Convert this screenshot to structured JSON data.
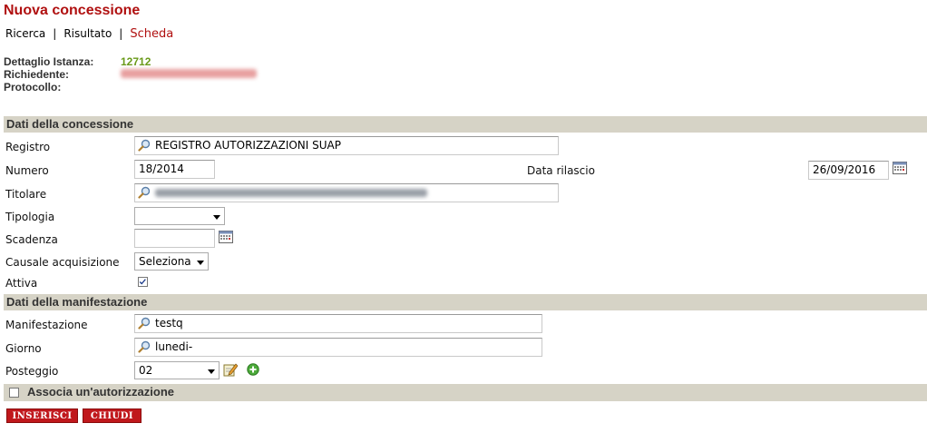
{
  "page_title": "Nuova concessione",
  "breadcrumbs": [
    {
      "label": "Ricerca"
    },
    {
      "label": "Risultato"
    },
    {
      "label": "Scheda"
    }
  ],
  "breadcrumb_separator": "|",
  "detail": {
    "istanza_label": "Dettaglio Istanza:",
    "istanza_value": "12712",
    "richiedente_label": "Richiedente:",
    "protocollo_label": "Protocollo:"
  },
  "sections": {
    "concessione": "Dati della concessione",
    "manifestazione": "Dati della manifestazione",
    "autorizzazione": "Associa un'autorizzazione"
  },
  "form": {
    "registro_label": "Registro",
    "registro_value": "REGISTRO AUTORIZZAZIONI SUAP",
    "numero_label": "Numero",
    "numero_value": "18/2014",
    "data_rilascio_label": "Data rilascio",
    "data_rilascio_value": "26/09/2016",
    "titolare_label": "Titolare",
    "tipologia_label": "Tipologia",
    "tipologia_value": "",
    "scadenza_label": "Scadenza",
    "scadenza_value": "",
    "causale_label": "Causale acquisizione",
    "causale_value": "Seleziona",
    "attiva_label": "Attiva",
    "attiva_checked": true,
    "manifestazione_label": "Manifestazione",
    "manifestazione_value": "testq",
    "giorno_label": "Giorno",
    "giorno_value": "lunedi-",
    "posteggio_label": "Posteggio",
    "posteggio_value": "02"
  },
  "buttons": {
    "inserisci": "INSERISCI",
    "chiudi": "CHIUDI"
  },
  "colors": {
    "title": "#b01010",
    "accent_green": "#6a9a1a",
    "section_bg": "#d6d3c6",
    "button_bg": "#c0181c"
  },
  "icons": [
    "magnifier-icon",
    "calendar-icon",
    "edit-icon",
    "add-icon",
    "chevron-down-icon"
  ]
}
